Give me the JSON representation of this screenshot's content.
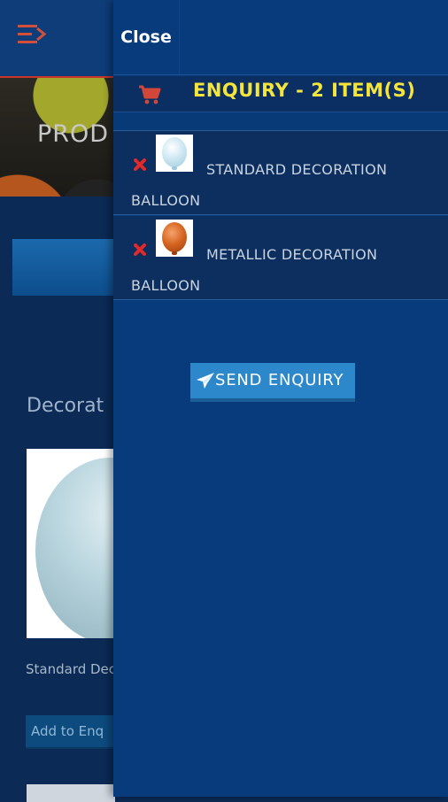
{
  "background_page": {
    "hero_text": "PROD",
    "section_title": "Decorat",
    "product_name": "Standard Dec Balloon",
    "add_button_label": "Add to Enq"
  },
  "drawer": {
    "close_label": "Close",
    "enquiry_title": "ENQUIRY - 2 ITEM(S)",
    "items": [
      {
        "name": "STANDARD DECORATION BALLOON",
        "thumbnail_color": "#cfe8f3"
      },
      {
        "name": "METALLIC DECORATION BALLOON",
        "thumbnail_color": "#d4621e"
      }
    ],
    "send_button_label": "SEND ENQUIRY"
  },
  "icons": {
    "menu": "menu-icon",
    "cart": "cart-icon",
    "remove": "remove-icon",
    "send": "paper-plane-icon"
  },
  "colors": {
    "accent_yellow": "#f5e53b",
    "remove_red": "#e02a2a",
    "drawer_bg": "#083b7c",
    "send_button": "#2c88cb"
  }
}
